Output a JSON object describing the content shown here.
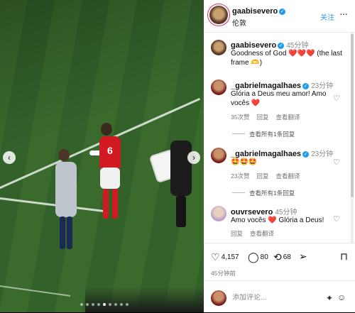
{
  "post": {
    "author": "gaabisevero",
    "location": "伦敦",
    "follow_label": "关注",
    "more_label": "···",
    "caption": {
      "author": "gaabisevero",
      "time": "45分钟",
      "text": "Goodness of God ❤️❤️❤️ (the last frame 🫶)"
    }
  },
  "comments": [
    {
      "author": "_gabrielmagalhaes",
      "time": "23分钟",
      "text": "Glória a Deus meu amor! Amo vocês ❤️",
      "likes": "35次赞",
      "reply_label": "回复",
      "translate_label": "查看翻译",
      "view_replies": "查看所有1条回复"
    },
    {
      "author": "_gabrielmagalhaes",
      "time": "23分钟",
      "text": "🤩🤩🤩",
      "likes": "23次赞",
      "reply_label": "回复",
      "translate_label": "查看翻译",
      "view_replies": "查看所有1条回复"
    },
    {
      "author": "ouvrsevero",
      "time": "45分钟",
      "text": "Amo vocês ❤️ Glória a Deus!",
      "reply_label": "回复",
      "translate_label": "查看翻译"
    }
  ],
  "actions": {
    "likes": "4,157",
    "comments": "80",
    "reposts": "68"
  },
  "time_ago": "45分钟前",
  "comment_input": {
    "placeholder": "添加评论..."
  },
  "icons": [
    "chevron-left-icon",
    "chevron-right-icon",
    "verified-icon",
    "heart-icon",
    "comment-icon",
    "repost-icon",
    "share-icon",
    "bookmark-icon",
    "emoji-icon",
    "more-icon"
  ],
  "colors": {
    "link": "#3897f0",
    "verified": "#1d9bf0",
    "heart": "#e0245e",
    "jersey": "#d11a22"
  },
  "carousel": {
    "current": 5,
    "total": 9
  }
}
